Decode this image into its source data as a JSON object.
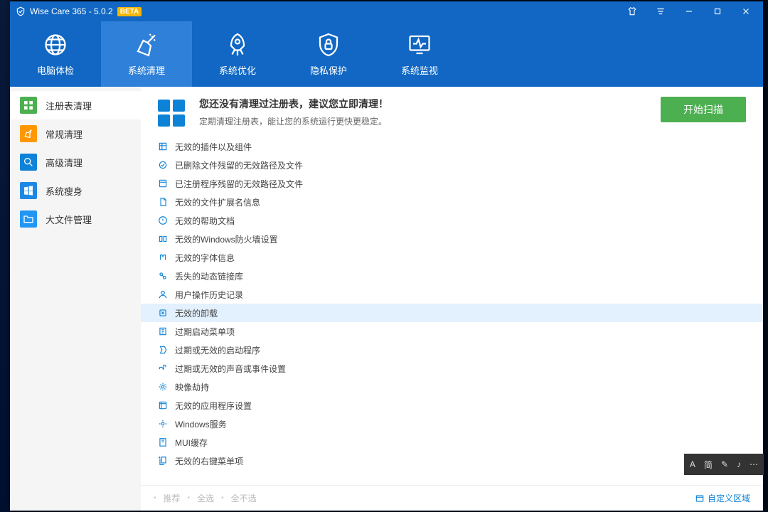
{
  "titlebar": {
    "title": "Wise Care 365 - 5.0.2",
    "badge": "BETA"
  },
  "nav": [
    {
      "label": "电脑体检"
    },
    {
      "label": "系统清理"
    },
    {
      "label": "系统优化"
    },
    {
      "label": "隐私保护"
    },
    {
      "label": "系统监视"
    }
  ],
  "sidebar": [
    {
      "label": "注册表清理"
    },
    {
      "label": "常规清理"
    },
    {
      "label": "高级清理"
    },
    {
      "label": "系统瘦身"
    },
    {
      "label": "大文件管理"
    }
  ],
  "header": {
    "title": "您还没有清理过注册表，建议您立即清理！",
    "subtitle": "定期清理注册表，能让您的系统运行更快更稳定。",
    "scan_btn": "开始扫描"
  },
  "items": [
    "无效的插件以及组件",
    "已删除文件残留的无效路径及文件",
    "已注册程序残留的无效路径及文件",
    "无效的文件扩展名信息",
    "无效的帮助文档",
    "无效的Windows防火墙设置",
    "无效的字体信息",
    "丢失的动态链接库",
    "用户操作历史记录",
    "无效的卸载",
    "过期启动菜单项",
    "过期或无效的启动程序",
    "过期或无效的声音或事件设置",
    "映像劫持",
    "无效的应用程序设置",
    "Windows服务",
    "MUI缓存",
    "无效的右键菜单项"
  ],
  "hover_index": 9,
  "bottom": {
    "recommend": "推荐",
    "select_all": "全选",
    "select_none": "全不选",
    "custom_area": "自定义区域"
  },
  "ime": {
    "a": "A",
    "mode": "简",
    "dot": "♪",
    "ellipsis": "⋯"
  }
}
